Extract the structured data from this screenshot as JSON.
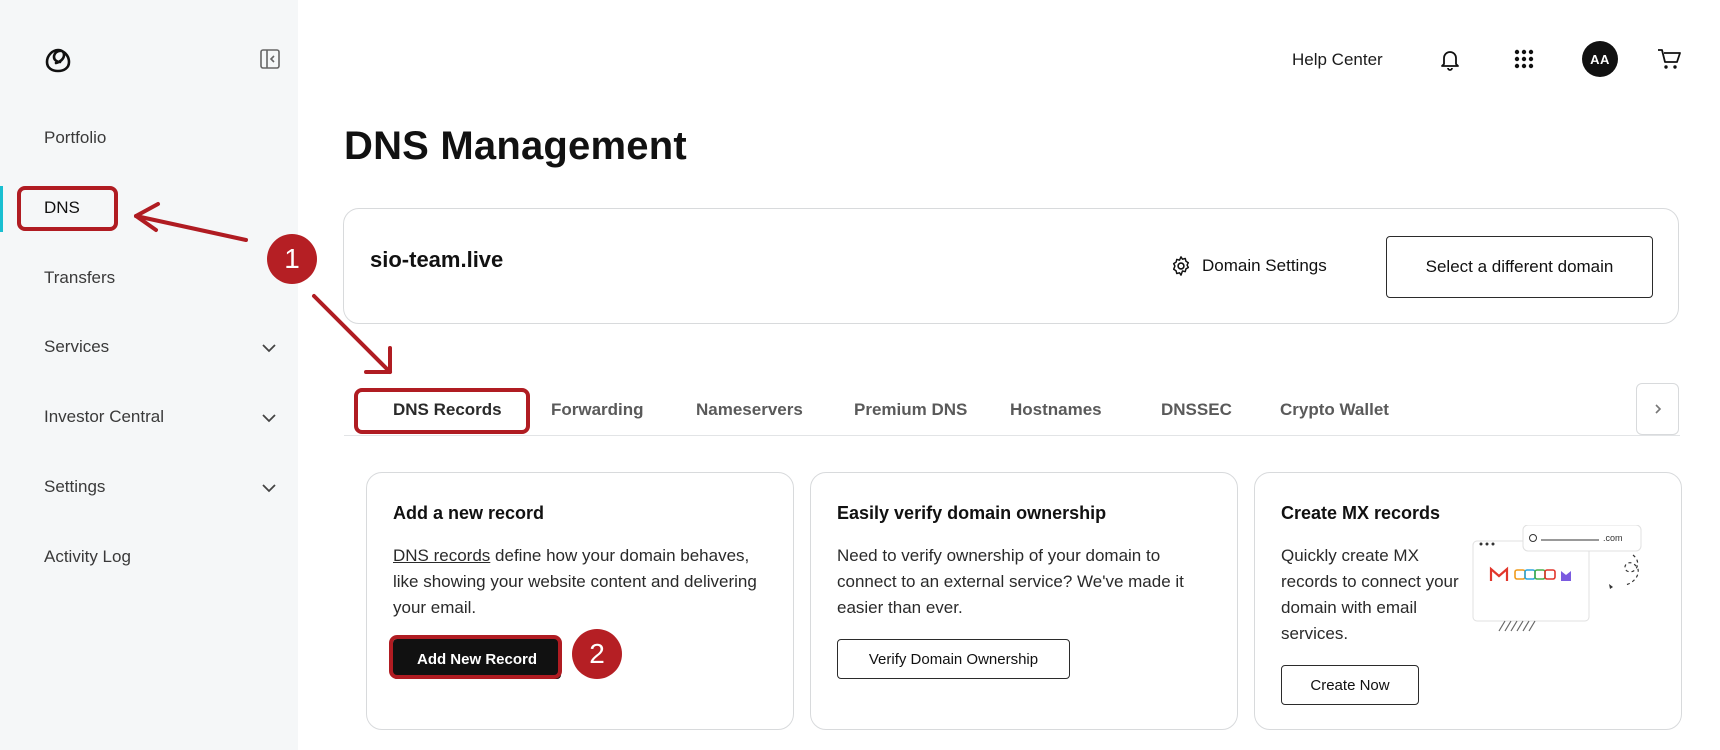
{
  "sidebar": {
    "logo_icon": "godaddy-logo-icon",
    "collapse_icon": "sidebar-collapse-icon",
    "items": [
      {
        "label": "Portfolio",
        "has_chevron": false
      },
      {
        "label": "DNS",
        "has_chevron": false,
        "active": true
      },
      {
        "label": "Transfers",
        "has_chevron": false
      },
      {
        "label": "Services",
        "has_chevron": true
      },
      {
        "label": "Investor Central",
        "has_chevron": true
      },
      {
        "label": "Settings",
        "has_chevron": true
      },
      {
        "label": "Activity Log",
        "has_chevron": false
      }
    ]
  },
  "topbar": {
    "help_label": "Help Center",
    "avatar_initials": "AA",
    "icons": [
      "bell-icon",
      "apps-grid-icon",
      "cart-icon"
    ]
  },
  "page": {
    "title": "DNS Management"
  },
  "domain_card": {
    "domain": "sio-team.live",
    "settings_label": "Domain Settings",
    "select_label": "Select a different domain"
  },
  "tabs": [
    {
      "label": "DNS Records",
      "active": true
    },
    {
      "label": "Forwarding"
    },
    {
      "label": "Nameservers"
    },
    {
      "label": "Premium DNS"
    },
    {
      "label": "Hostnames"
    },
    {
      "label": "DNSSEC"
    },
    {
      "label": "Crypto Wallet"
    }
  ],
  "cards": [
    {
      "title": "Add a new record",
      "link": "DNS records",
      "body": " define how your domain behaves, like showing your website content and delivering your email.",
      "button": "Add New Record"
    },
    {
      "title": "Easily verify domain ownership",
      "body": "Need to verify ownership of your domain to connect to an external service? We've made it easier than ever.",
      "button": "Verify Domain Ownership"
    },
    {
      "title": "Create MX records",
      "body": "Quickly create MX records to connect your domain with email services.",
      "button": "Create Now",
      "illustration_text": ".com"
    }
  ],
  "annotations": {
    "step1": "1",
    "step2": "2",
    "color": "#b01c22"
  },
  "colors": {
    "accent": "#19bfd1",
    "sidebar_bg": "#f5f7f8",
    "primary_button": "#111111"
  }
}
